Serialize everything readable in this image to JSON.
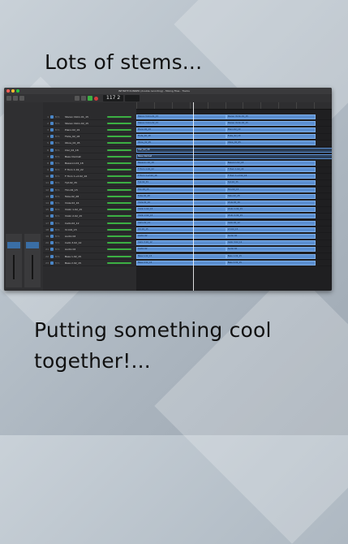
{
  "captions": {
    "top": "Lots of stems...",
    "bottom_line1": "Putting something cool",
    "bottom_line2": "together!..."
  },
  "daw": {
    "window_title": "INFINITE RUNNER (double recording) - Mixing Files - Tracks",
    "lcd_value": "117 2",
    "colors": {
      "region": "#5b8fd1",
      "play": "#3cb043",
      "record": "#d23c3c"
    },
    "tracks": [
      "Stereo Violin.01_15",
      "Stereo Violin.02_15",
      "Piano.02_19",
      "Flute_02_18",
      "Oboe_02_05",
      "Clar_02_18",
      "Bass Clarinet",
      "Bassoon.02_18",
      "F Horn 1.02_22",
      "F Horn 1+2.02_16",
      "Tpt.02_35",
      "Tbn.02_15",
      "Tuba.02_28",
      "Viola.02_16",
      "Violin 1.02_15",
      "Violin 2.02_15",
      "Cello.02_12",
      "Vcl.02_15",
      "Audio 02",
      "Cello 3.02_12",
      "Audio 02",
      "Bass 1.02_15",
      "Bass 2.02_15"
    ]
  }
}
